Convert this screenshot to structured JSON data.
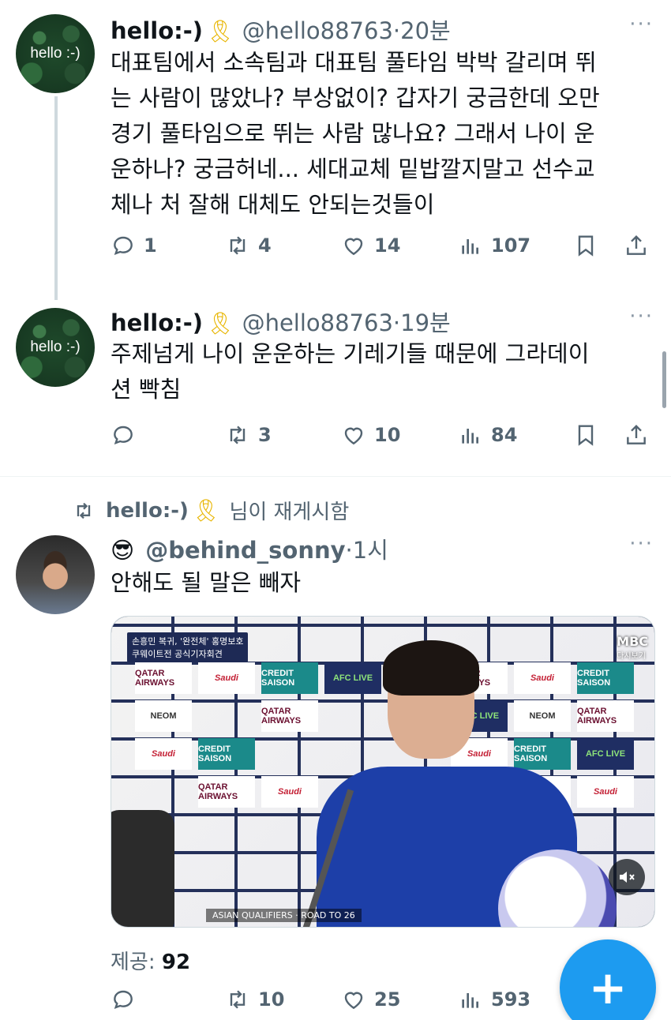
{
  "tweets": [
    {
      "avatar_text": "hello :-)",
      "name": "hello:-)",
      "ribbon": "🎗",
      "handle": "@hello88763",
      "time": "20분",
      "more": "···",
      "text": "대표팀에서 소속팀과 대표팀 풀타임 박박 갈리며 뛰\n는 사람이 많았나? 부상없이? 갑자기 궁금한데 오만\n경기 풀타임으로 뛰는 사람 많나요? 그래서 나이 운\n운하나? 궁금허네... 세대교체 밑밥깔지말고 선수교\n체나 처 잘해 대체도 안되는것들이",
      "replies": "1",
      "reposts": "4",
      "likes": "14",
      "views": "107"
    },
    {
      "avatar_text": "hello :-)",
      "name": "hello:-)",
      "ribbon": "🎗",
      "handle": "@hello88763",
      "time": "19분",
      "more": "···",
      "text": "주제넘게 나이 운운하는 기레기들 때문에 그라데이\n션 빡침",
      "replies": "",
      "reposts": "3",
      "likes": "10",
      "views": "84"
    },
    {
      "retweeted_by_name": "hello:-)",
      "retweeted_by_ribbon": "🎗",
      "retweeted_suffix": "님이 재게시함",
      "emoji": "😎",
      "handle": "@behind_sonny",
      "time": "1시",
      "more": "···",
      "text": "안해도 될 말은 빼자",
      "provided_label": "제공:",
      "provided_count": "92",
      "replies": "",
      "reposts": "10",
      "likes": "25",
      "views": "593"
    }
  ],
  "media": {
    "banner_line1": "손흥민 복귀, '완전체' 홍명보호",
    "banner_line2": "쿠웨이트전 공식기자회견",
    "channel_logo": "MBC",
    "replay_label": "다시보기",
    "ticker": "ASIAN QUALIFIERS · ROAD TO 26",
    "mute_icon": "speaker-muted",
    "sponsors": [
      "QATAR AIRWAYS",
      "Saudi",
      "CREDIT SAISON",
      "NEOM",
      "AFC LIVE"
    ]
  },
  "fab_label": "+",
  "colors": {
    "accent": "#1d9bf0",
    "secondary_text": "#536471",
    "ribbon": "#e8b500"
  }
}
